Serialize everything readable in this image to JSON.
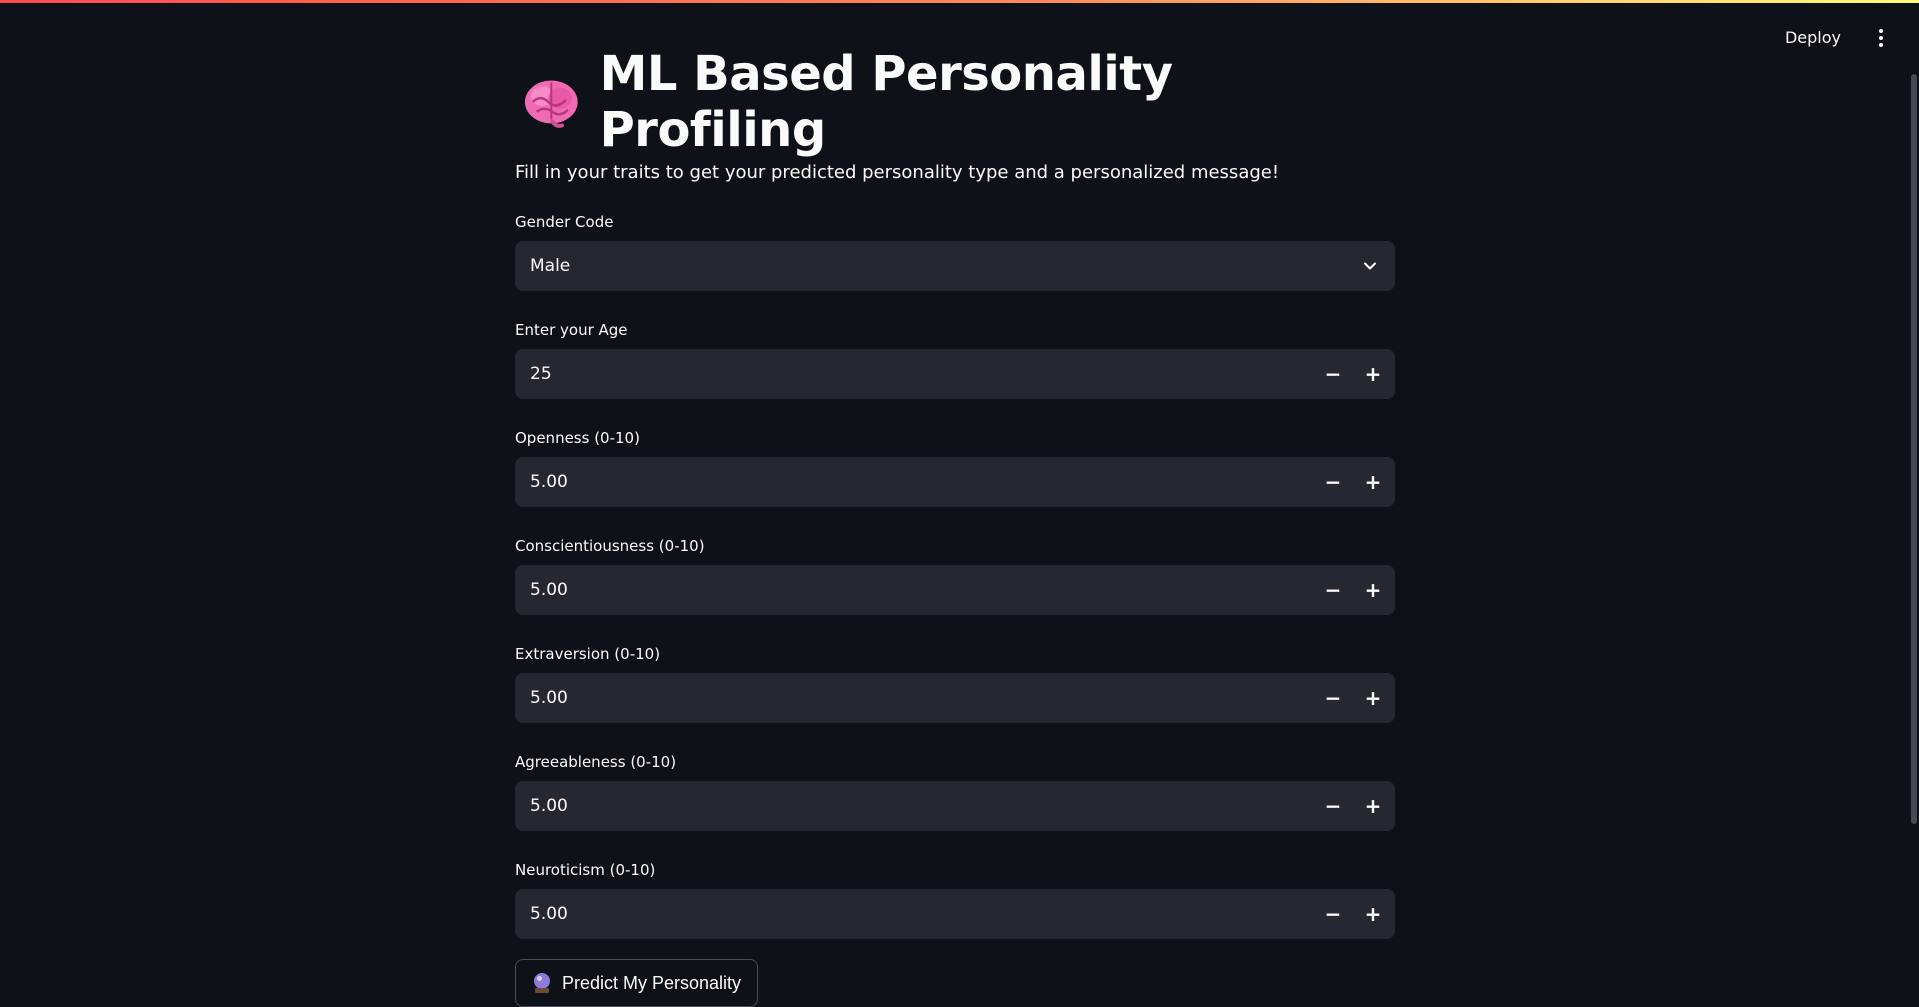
{
  "header": {
    "deploy_label": "Deploy",
    "menu_icon": "kebab-menu-icon"
  },
  "page": {
    "title": "ML Based Personality Profiling",
    "title_icon": "brain-icon",
    "subtitle": "Fill in your traits to get your predicted personality type and a personalized message!"
  },
  "form": {
    "gender": {
      "label": "Gender Code",
      "value": "Male"
    },
    "age": {
      "label": "Enter your Age",
      "value": "25"
    },
    "openness": {
      "label": "Openness (0-10)",
      "value": "5.00"
    },
    "conscientiousness": {
      "label": "Conscientiousness (0-10)",
      "value": "5.00"
    },
    "extraversion": {
      "label": "Extraversion (0-10)",
      "value": "5.00"
    },
    "agreeableness": {
      "label": "Agreeableness (0-10)",
      "value": "5.00"
    },
    "neuroticism": {
      "label": "Neuroticism (0-10)",
      "value": "5.00"
    },
    "minus_symbol": "−",
    "plus_symbol": "+",
    "submit_label": "Predict My Personality",
    "submit_icon": "crystal-ball-icon"
  },
  "colors": {
    "background": "#0e1117",
    "input_background": "#262730",
    "text": "#fafafa",
    "accent_gradient_start": "#ff4b4b",
    "accent_gradient_end": "#fffd80"
  }
}
